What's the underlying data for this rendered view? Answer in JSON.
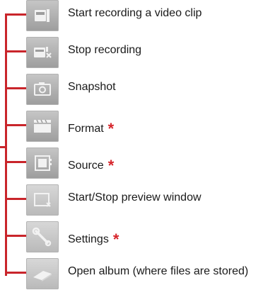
{
  "items": [
    {
      "label": "Start recording a video clip",
      "icon": "video-camera-icon",
      "starred": false
    },
    {
      "label": "Stop recording",
      "icon": "stop-recording-icon",
      "starred": false
    },
    {
      "label": "Snapshot",
      "icon": "snapshot-camera-icon",
      "starred": false
    },
    {
      "label": "Format",
      "icon": "clapperboard-icon",
      "starred": true
    },
    {
      "label": "Source",
      "icon": "source-film-icon",
      "starred": true
    },
    {
      "label": "Start/Stop preview window",
      "icon": "preview-window-icon",
      "starred": false
    },
    {
      "label": "Settings",
      "icon": "wrench-icon",
      "starred": true
    },
    {
      "label": "Open album (where files are stored)",
      "icon": "album-icon",
      "starred": false
    }
  ],
  "star_glyph": "*",
  "colors": {
    "bracket": "#c9252b",
    "star": "#d6262c",
    "button": "#a9a9a9"
  }
}
